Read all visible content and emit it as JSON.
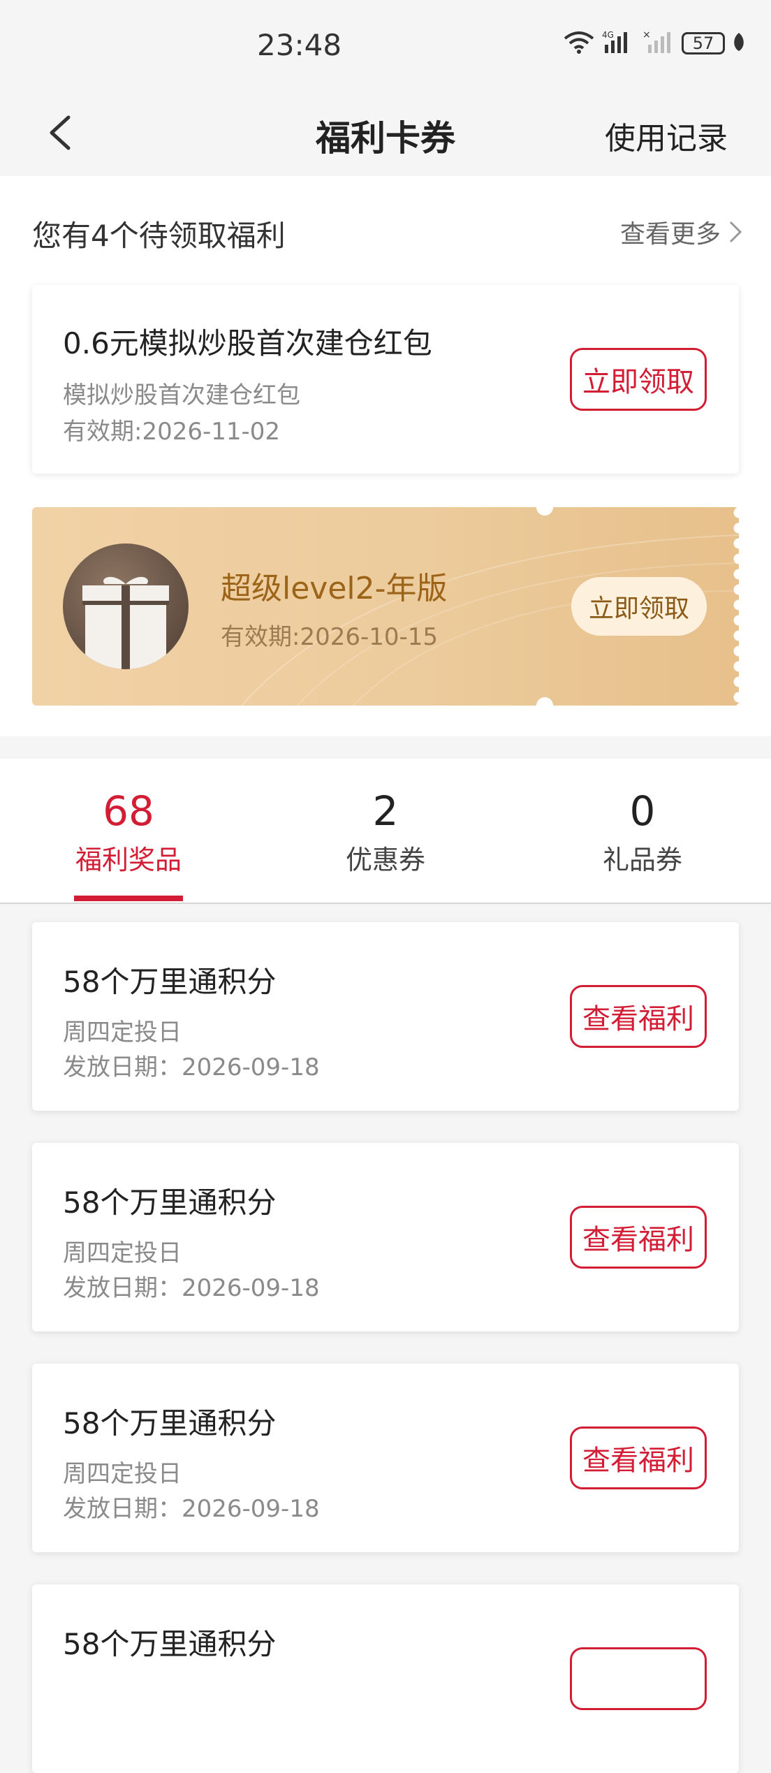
{
  "status_bar": {
    "time": "23:48",
    "network": "4G",
    "battery": "57",
    "icons": [
      "wifi-icon",
      "signal-4g-icon",
      "signal-nosim-icon",
      "battery-icon",
      "leaf-icon"
    ]
  },
  "nav": {
    "title": "福利卡券",
    "right_link": "使用记录"
  },
  "pending": {
    "title": "您有4个待领取福利",
    "see_more": "查看更多",
    "card1": {
      "title": "0.6元模拟炒股首次建仓红包",
      "subtitle": "模拟炒股首次建仓红包",
      "validity": "有效期:2026-11-02",
      "button": "立即领取"
    },
    "card2": {
      "title": "超级level2-年版",
      "validity": "有效期:2026-10-15",
      "button": "立即领取"
    }
  },
  "tabs": [
    {
      "count": "68",
      "label": "福利奖品"
    },
    {
      "count": "2",
      "label": "优惠券"
    },
    {
      "count": "0",
      "label": "礼品券"
    }
  ],
  "rewards": [
    {
      "title": "58个万里通积分",
      "desc": "周四定投日",
      "date": "发放日期：2026-09-18",
      "button": "查看福利"
    },
    {
      "title": "58个万里通积分",
      "desc": "周四定投日",
      "date": "发放日期：2026-09-18",
      "button": "查看福利"
    },
    {
      "title": "58个万里通积分",
      "desc": "周四定投日",
      "date": "发放日期：2026-09-18",
      "button": "查看福利"
    },
    {
      "title": "58个万里通积分",
      "desc": "",
      "date": "",
      "button": ""
    }
  ],
  "colors": {
    "accent": "#d21d35",
    "gold_text": "#9c6418",
    "background": "#f5f5f5"
  }
}
